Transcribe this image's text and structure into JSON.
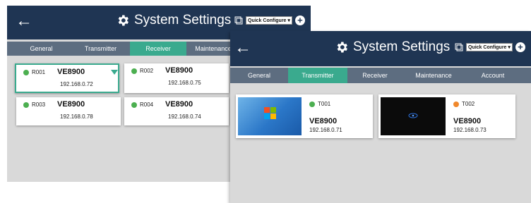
{
  "receiver_window": {
    "title": "System Settings",
    "quick_configure": "Quick Configure",
    "tabs": [
      "General",
      "Transmitter",
      "Receiver",
      "Maintenance"
    ],
    "active_tab": "Receiver",
    "devices": [
      {
        "id": "R001",
        "model": "VE8900",
        "ip": "192.168.0.72",
        "status": "online",
        "selected": true
      },
      {
        "id": "R002",
        "model": "VE8900",
        "ip": "192.168.0.75",
        "status": "online",
        "selected": false
      },
      {
        "id": "R003",
        "model": "VE8900",
        "ip": "192.168.0.78",
        "status": "online",
        "selected": false
      },
      {
        "id": "R004",
        "model": "VE8900",
        "ip": "192.168.0.74",
        "status": "online",
        "selected": false
      }
    ]
  },
  "transmitter_window": {
    "title": "System Settings",
    "quick_configure": "Quick Configure",
    "tabs": [
      "General",
      "Transmitter",
      "Receiver",
      "Maintenance",
      "Account"
    ],
    "active_tab": "Transmitter",
    "devices": [
      {
        "id": "T001",
        "model": "VE8900",
        "ip": "192.168.0.71",
        "status": "online",
        "preview": "windows-desktop"
      },
      {
        "id": "T002",
        "model": "VE8900",
        "ip": "192.168.0.73",
        "status": "standby",
        "preview": "dark-screen"
      }
    ]
  },
  "icons": {
    "back": "arrow-left-icon",
    "settings": "gear-icon",
    "quick_config": "quick-configure-icon",
    "add": "plus-circle-icon"
  },
  "colors": {
    "header": "#1f3553",
    "tab_bar": "#5d6d80",
    "active_tab": "#3aaa8e",
    "online": "#4caf50",
    "standby": "#f0882c",
    "panel_bg": "#d9d9d9"
  }
}
